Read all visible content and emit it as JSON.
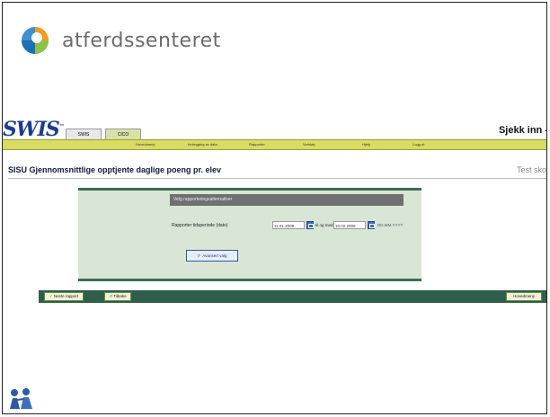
{
  "brand": {
    "name": "atferdssenteret"
  },
  "app": {
    "logo": "SWIS",
    "logo_tm": "™",
    "tabs": [
      "SWIS",
      "CICO"
    ],
    "checkin": "Sjekk inn -",
    "menu": [
      "Hovedmeny",
      "Innlegging av data",
      "Rapporter",
      "Verktøy",
      "Hjelp",
      "Logg ut"
    ],
    "page_title": "SISU Gjennomsnittlige opptjente daglige poeng pr. elev",
    "org_name": "Test skol",
    "panel": {
      "header": "Velg rapporteringsalternativer",
      "period_label": "Rapporter tidsperiode (dato)",
      "from_date": "11.01.2009",
      "til_label": "til og med",
      "to_date": "10.02.2009",
      "format_hint": "DD.MM.YYYY",
      "cancel_label": "Avansert valg"
    },
    "actions": {
      "next": "Neste rapport",
      "back": "Tilbake",
      "main_menu": "Hovedmeny"
    }
  },
  "colors": {
    "menu_bar": "#d7dd63",
    "panel_bg": "#d9e6d5",
    "panel_border": "#3c6d55",
    "action_bar": "#2f5e4a",
    "logo_blue": "#1d3b8a"
  },
  "icons": [
    "atferdssenteret-logo-icon",
    "calendar-icon",
    "refresh-icon",
    "check-icon",
    "back-icon",
    "children-icon"
  ]
}
